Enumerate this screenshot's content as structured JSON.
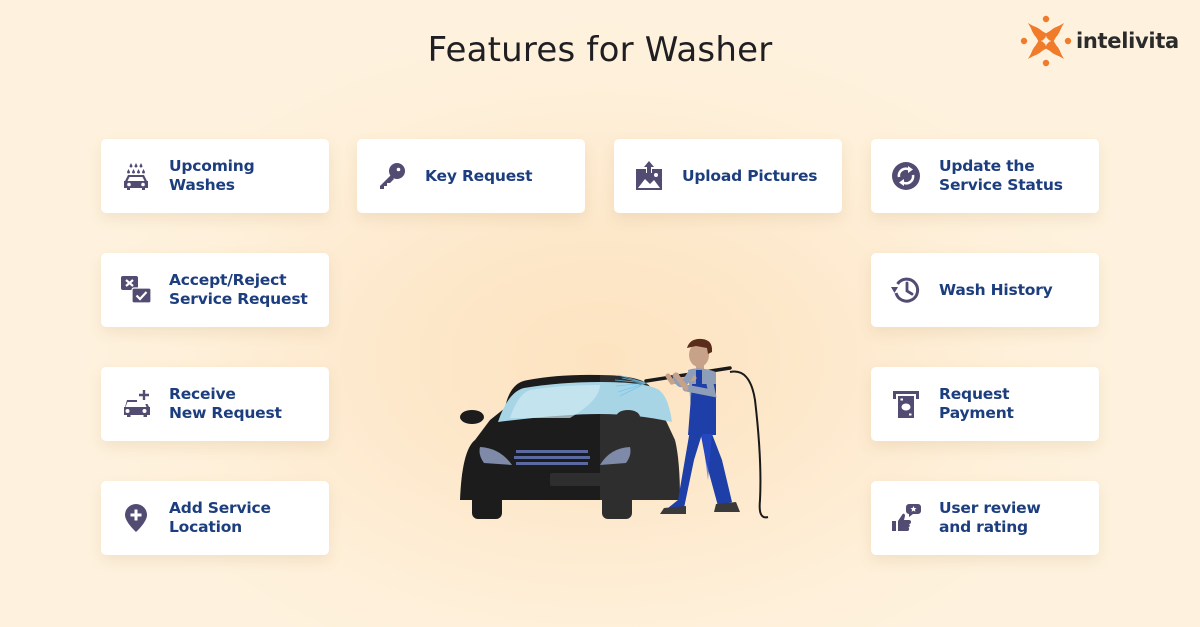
{
  "header": {
    "title": "Features for Washer"
  },
  "brand": {
    "name": "intelivita",
    "logo_icon": "intelivita-logo-icon",
    "accent_color": "#f07b2a"
  },
  "colors": {
    "card_text": "#1d3e7e",
    "icon": "#524c72",
    "card_bg": "#ffffff"
  },
  "features": [
    {
      "label": "Upcoming\nWashes",
      "icon": "car-wash-icon"
    },
    {
      "label": "Key Request",
      "icon": "key-icon"
    },
    {
      "label": "Upload Pictures",
      "icon": "upload-image-icon"
    },
    {
      "label": "Update the\nService Status",
      "icon": "refresh-status-icon"
    },
    {
      "label": "Accept/Reject\nService Request",
      "icon": "accept-reject-icon"
    },
    {
      "label": "Wash History",
      "icon": "history-icon"
    },
    {
      "label": "Receive\nNew Request",
      "icon": "car-add-icon"
    },
    {
      "label": "Request\nPayment",
      "icon": "atm-payment-icon"
    },
    {
      "label": "Add Service\nLocation",
      "icon": "location-add-icon"
    },
    {
      "label": "User review\nand rating",
      "icon": "thumbs-up-review-icon"
    }
  ],
  "illustration": {
    "subject": "washer-cleaning-car-illustration"
  }
}
